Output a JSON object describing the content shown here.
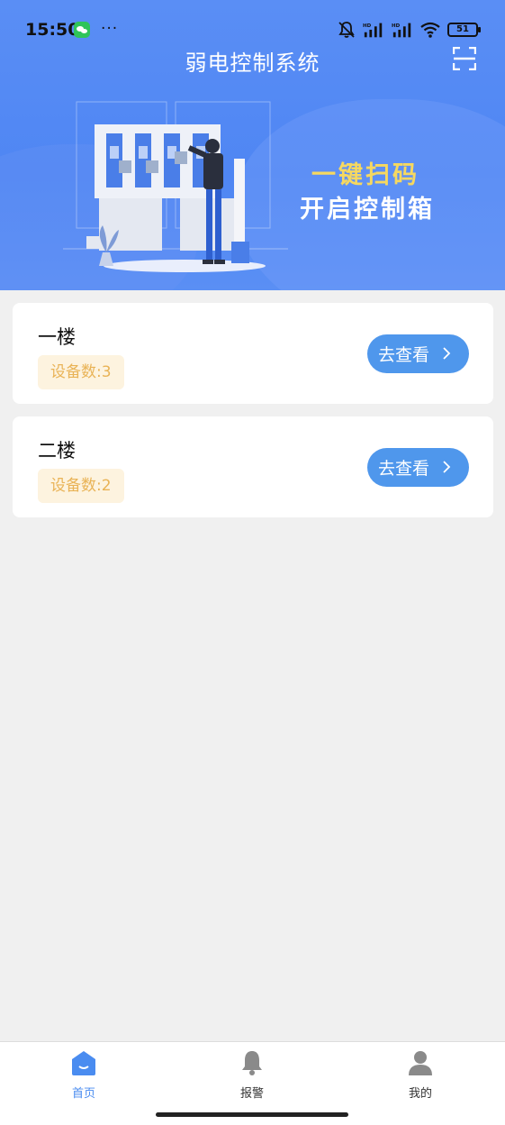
{
  "status_bar": {
    "time": "15:50",
    "dots": "···",
    "battery": "51",
    "icons": [
      "wechat-icon",
      "bell-off-icon",
      "signal-hd-icon",
      "signal-hd-icon",
      "wifi-icon",
      "battery-icon"
    ]
  },
  "header": {
    "title": "弱电控制系统",
    "scan_icon": "scan-icon"
  },
  "banner": {
    "line1": "一键扫码",
    "line2": "开启控制箱",
    "colors": {
      "line1": "#f6d860",
      "line2": "#ffffff",
      "background": "#4f86f3"
    }
  },
  "floors": [
    {
      "name": "一楼",
      "device_label": "设备数:3",
      "button_label": "去查看"
    },
    {
      "name": "二楼",
      "device_label": "设备数:2",
      "button_label": "去查看"
    }
  ],
  "tabbar": {
    "active": 0,
    "tabs": [
      {
        "label": "首页",
        "icon": "home-icon"
      },
      {
        "label": "报警",
        "icon": "bell-icon"
      },
      {
        "label": "我的",
        "icon": "user-icon"
      }
    ]
  },
  "colors": {
    "accent": "#4f97ec",
    "badge_bg": "#fdf3df",
    "badge_text": "#e9b356",
    "page_bg": "#f0f0f0"
  }
}
